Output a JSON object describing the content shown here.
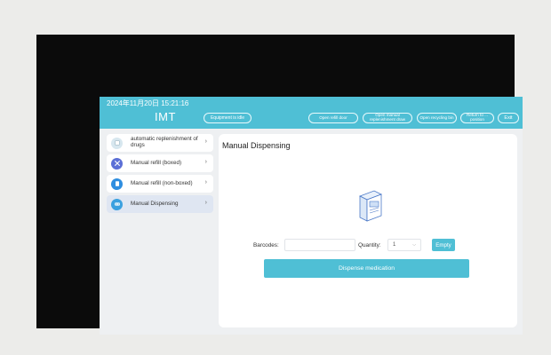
{
  "header": {
    "datetime": "2024年11月20日 15:21:16",
    "brand": "IMT",
    "status": "Equipment is idle",
    "actions": [
      {
        "label": "Open refill door"
      },
      {
        "label": "Open manual replenishment draw"
      },
      {
        "label": "Open recycling bin"
      },
      {
        "label": "Return to ... position"
      },
      {
        "label": "Exit"
      }
    ]
  },
  "sidebar": {
    "items": [
      {
        "label": "automatic replenishment of drugs",
        "icon": "drug-box-icon",
        "icon_color": "#d7e7ef"
      },
      {
        "label": "Manual refill (boxed)",
        "icon": "refill-boxed-icon",
        "icon_color": "#5b6fd6"
      },
      {
        "label": "Manual refill (non-boxed)",
        "icon": "refill-nonboxed-icon",
        "icon_color": "#2f8ee0"
      },
      {
        "label": "Manual Dispensing",
        "icon": "dispense-icon",
        "icon_color": "#3aa0df"
      }
    ],
    "active_index": 3
  },
  "main": {
    "title": "Manual Dispensing",
    "barcode_label": "Barcodes:",
    "barcode_value": "",
    "quantity_label": "Quantity:",
    "quantity_value": "1",
    "empty_label": "Empty",
    "dispense_label": "Dispense medication"
  },
  "colors": {
    "accent": "#4fbfd5",
    "bezel": "#0b0b0b",
    "panel_bg": "#ffffff",
    "screen_bg": "#eef0f2"
  }
}
